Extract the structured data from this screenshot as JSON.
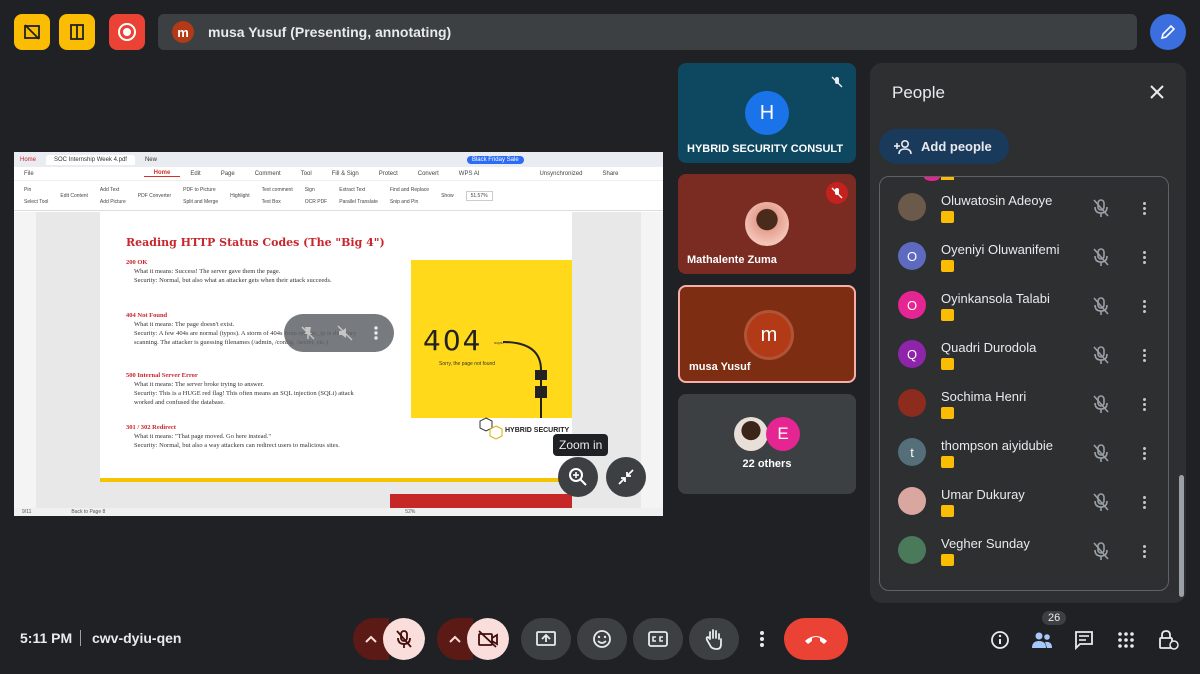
{
  "topbar": {
    "presenter_initial": "m",
    "presenter_text": "musa Yusuf (Presenting, annotating)"
  },
  "shared_screen": {
    "app_tabs": [
      "Home",
      "SOC Internship Week 4.pdf",
      "New",
      "Black Friday Sale"
    ],
    "menu": [
      "File",
      "Home",
      "Edit",
      "Page",
      "Comment",
      "Tool",
      "Fill & Sign",
      "Protect",
      "Convert",
      "WPS AI",
      "Unsynchronized",
      "Share"
    ],
    "ribbon": [
      "Pin",
      "Select Tool",
      "Edit Content",
      "Add Text",
      "Add Picture",
      "PDF Converter",
      "PDF to Picture",
      "Split and Merge",
      "Highlight",
      "Text comment",
      "Text Box",
      "Sign",
      "OCR PDF",
      "Extract Text",
      "Parallel Translate",
      "Find and Replace",
      "Snip and Pin",
      "Show",
      "51.57%"
    ],
    "doc_title": "Reading HTTP Status Codes (The \"Big 4\")",
    "sections": [
      {
        "code": "200 OK",
        "l1": "What it means: Success! The server gave them the page.",
        "l2": "Security: Normal, but also what an attacker gets when their attack succeeds."
      },
      {
        "code": "404 Not Found",
        "l1": "What it means: The page doesn't exist.",
        "l2": "Security: A few 404s are normal (typos). A storm of 404s from one src_ip is directory scanning. The attacker is guessing filenames (/admin, /config, /secret, etc.)"
      },
      {
        "code": "500 Internal Server Error",
        "l1": "What it means: The server broke trying to answer.",
        "l2": "Security: This is a HUGE red flag! This often means an SQL injection (SQLi) attack worked and confused the database."
      },
      {
        "code": "301 / 302 Redirect",
        "l1": "What it means: \"That page moved. Go here instead.\"",
        "l2": "Security: Normal, but also a way attackers can redirect users to malicious sites."
      }
    ],
    "img_404": "404",
    "img_404_oops": "oops!",
    "img_404_sub": "Sorry, the page not found",
    "logo_text": "HYBRID SECURITY",
    "status_page": "9/11",
    "status_back": "Back to Page 8",
    "status_zoom": "52%",
    "zoom_tooltip": "Zoom in"
  },
  "tiles": [
    {
      "name": "HYBRID SECURITY CONSULT",
      "initial": "H"
    },
    {
      "name": "Mathalente Zuma"
    },
    {
      "name": "musa Yusuf",
      "initial": "m"
    },
    {
      "others_label": "22 others",
      "initial": "E"
    }
  ],
  "people": {
    "title": "People",
    "add_label": "Add people",
    "list": [
      {
        "name": "Oluwatosin Adeoye",
        "initial": "",
        "color": "#6b5a4a"
      },
      {
        "name": "Oyeniyi Oluwanifemi",
        "initial": "O",
        "color": "#5c6bc0"
      },
      {
        "name": "Oyinkansola Talabi",
        "initial": "O",
        "color": "#e52592"
      },
      {
        "name": "Quadri Durodola",
        "initial": "Q",
        "color": "#8e24aa"
      },
      {
        "name": "Sochima Henri",
        "initial": "",
        "color": "#8d2b1e"
      },
      {
        "name": "thompson aiyidubie",
        "initial": "t",
        "color": "#546e7a"
      },
      {
        "name": "Umar Dukuray",
        "initial": "",
        "color": "#d9a6a0"
      },
      {
        "name": "Vegher Sunday",
        "initial": "",
        "color": "#4a7a5a"
      }
    ]
  },
  "bottombar": {
    "time": "5:11 PM",
    "meeting_code": "cwv-dyiu-qen",
    "participant_count": "26"
  }
}
